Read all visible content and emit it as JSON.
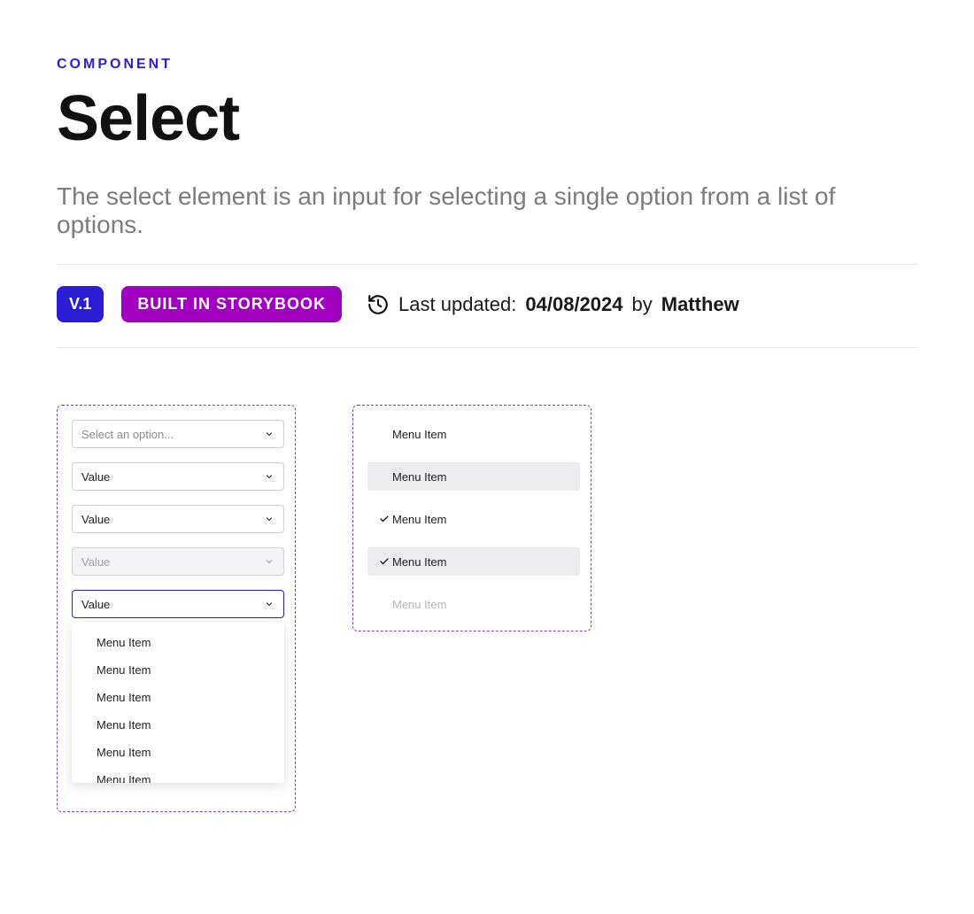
{
  "header": {
    "eyebrow": "COMPONENT",
    "title": "Select",
    "subtitle": "The select element is an input for selecting a single option from a list of options."
  },
  "meta": {
    "version": "V.1",
    "storybook": "BUILT IN STORYBOOK",
    "updated_label": "Last updated:",
    "date": "04/08/2024",
    "by_label": "by",
    "author": "Matthew"
  },
  "selects": {
    "placeholder": "Select an option...",
    "value1": "Value",
    "value2": "Value",
    "disabled": "Value",
    "focused": "Value"
  },
  "dropdown_items": [
    "Menu Item",
    "Menu Item",
    "Menu Item",
    "Menu Item",
    "Menu Item",
    "Menu Item"
  ],
  "menu_states": {
    "default": "Menu Item",
    "hover": "Menu Item",
    "selected": "Menu Item",
    "selected_hover": "Menu Item",
    "disabled": "Menu Item"
  }
}
